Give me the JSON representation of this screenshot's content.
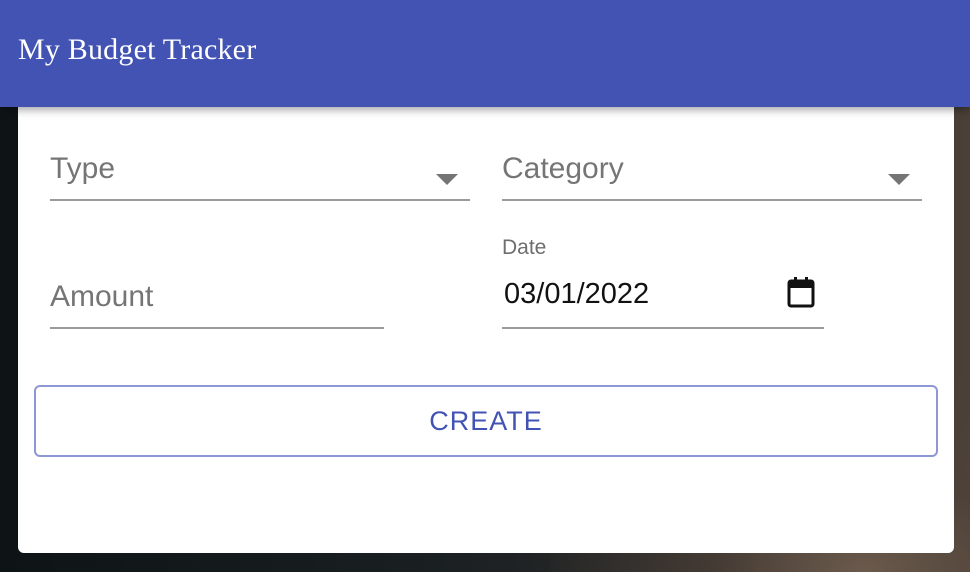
{
  "app": {
    "title": "My Budget Tracker"
  },
  "form": {
    "type": {
      "placeholder": "Type",
      "icon": "dropdown-caret-icon"
    },
    "category": {
      "placeholder": "Category",
      "icon": "dropdown-caret-icon"
    },
    "amount": {
      "placeholder": "Amount"
    },
    "date": {
      "label": "Date",
      "value": "03/01/2022",
      "icon": "calendar-icon"
    },
    "create_label": "CREATE"
  },
  "colors": {
    "appbar": "#4253b3",
    "button_text": "#4253b3",
    "button_border": "#8e97d6",
    "field_underline": "#9a9a9a",
    "placeholder": "#757575"
  }
}
